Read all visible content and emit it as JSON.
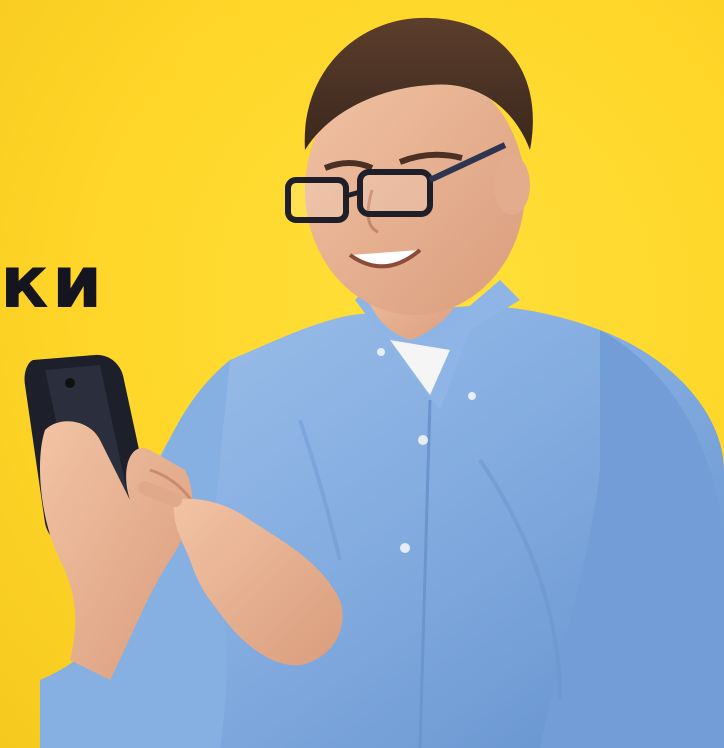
{
  "banner": {
    "headline": "ки",
    "background_color": "#FFD629",
    "shirt_color": "#7FA9DE",
    "text_color": "#15151F"
  },
  "illustration": {
    "subject": "smiling-man-with-glasses-holding-smartphone",
    "icons": [
      "glasses-icon",
      "smartphone-icon"
    ]
  }
}
